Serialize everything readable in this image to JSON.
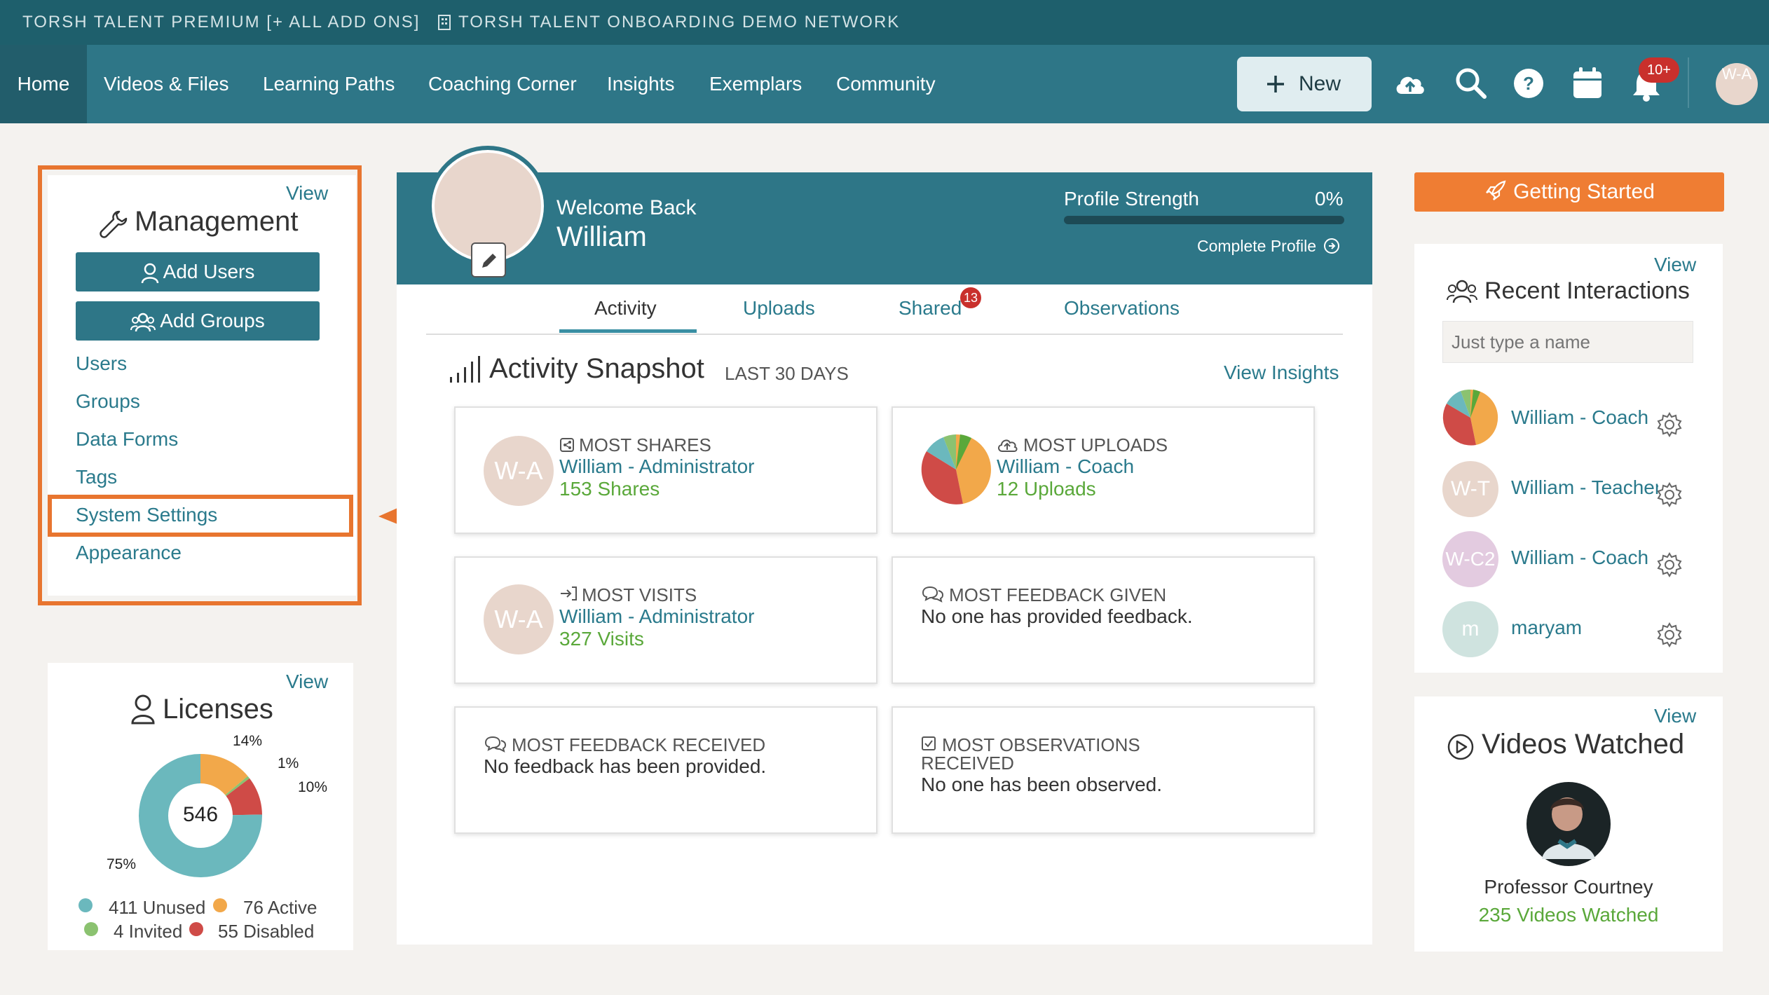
{
  "topbar": {
    "org": "TORSH TALENT PREMIUM [+ ALL ADD ONS]",
    "network": "TORSH TALENT ONBOARDING DEMO NETWORK"
  },
  "nav": {
    "items": [
      "Home",
      "Videos & Files",
      "Learning Paths",
      "Coaching Corner",
      "Insights",
      "Exemplars",
      "Community"
    ],
    "new_label": "New",
    "notifications_badge": "10+",
    "avatar_initials": "W-A"
  },
  "management": {
    "view": "View",
    "title": "Management",
    "add_users": "Add Users",
    "add_groups": "Add Groups",
    "links": [
      "Users",
      "Groups",
      "Data Forms",
      "Tags",
      "System Settings",
      "Appearance"
    ]
  },
  "licenses": {
    "view": "View",
    "title": "Licenses",
    "total": "546",
    "pct_labels": [
      "14%",
      "1%",
      "10%",
      "75%"
    ],
    "legend": [
      {
        "label": "411 Unused",
        "color": "#6bb8bd"
      },
      {
        "label": "76 Active",
        "color": "#f2a84a"
      },
      {
        "label": "4 Invited",
        "color": "#8bc270"
      },
      {
        "label": "55 Disabled",
        "color": "#cf4b47"
      }
    ],
    "chart_data": {
      "type": "pie",
      "categories": [
        "Unused",
        "Active",
        "Invited",
        "Disabled"
      ],
      "values": [
        411,
        76,
        4,
        55
      ],
      "colors": [
        "#6bb8bd",
        "#f2a84a",
        "#8bc270",
        "#cf4b47"
      ]
    }
  },
  "welcome": {
    "greeting": "Welcome Back",
    "name": "William",
    "profile_strength_label": "Profile Strength",
    "profile_strength_value": "0%",
    "profile_strength_fraction": 0,
    "complete_profile": "Complete Profile"
  },
  "tabs": {
    "items": [
      "Activity",
      "Uploads",
      "Shared",
      "Observations"
    ],
    "shared_badge": "13"
  },
  "snapshot": {
    "title": "Activity Snapshot",
    "subtitle": "LAST 30 DAYS",
    "view_insights": "View Insights",
    "most_shares": {
      "label": "MOST SHARES",
      "name": "William - Administrator",
      "count": "153 Shares",
      "initials": "W-A"
    },
    "most_uploads": {
      "label": "MOST UPLOADS",
      "name": "William - Coach",
      "count": "12 Uploads"
    },
    "most_visits": {
      "label": "MOST VISITS",
      "name": "William - Administrator",
      "count": "327 Visits",
      "initials": "W-A"
    },
    "most_feedback_given": {
      "label": "MOST FEEDBACK GIVEN",
      "message": "No one has provided feedback."
    },
    "most_feedback_received": {
      "label": "MOST FEEDBACK RECEIVED",
      "message": "No feedback has been provided."
    },
    "most_observations": {
      "label_line1": "MOST OBSERVATIONS",
      "label_line2": "RECEIVED",
      "message": "No one has been observed."
    }
  },
  "getting_started": {
    "label": "Getting Started"
  },
  "recent_interactions": {
    "view": "View",
    "title": "Recent Interactions",
    "search_placeholder": "Just type a name",
    "people": [
      {
        "name": "William - Coach",
        "initials": "",
        "color": "#e8d6cc"
      },
      {
        "name": "William - Teacher",
        "initials": "W-T",
        "color": "#e8d6cc"
      },
      {
        "name": "William - Coach",
        "initials": "W-C2",
        "color": "#e3cbe0"
      },
      {
        "name": "maryam",
        "initials": "m",
        "color": "#cfe3df"
      }
    ]
  },
  "videos_watched": {
    "view": "View",
    "title": "Videos Watched",
    "person": "Professor Courtney",
    "count": "235 Videos Watched"
  }
}
